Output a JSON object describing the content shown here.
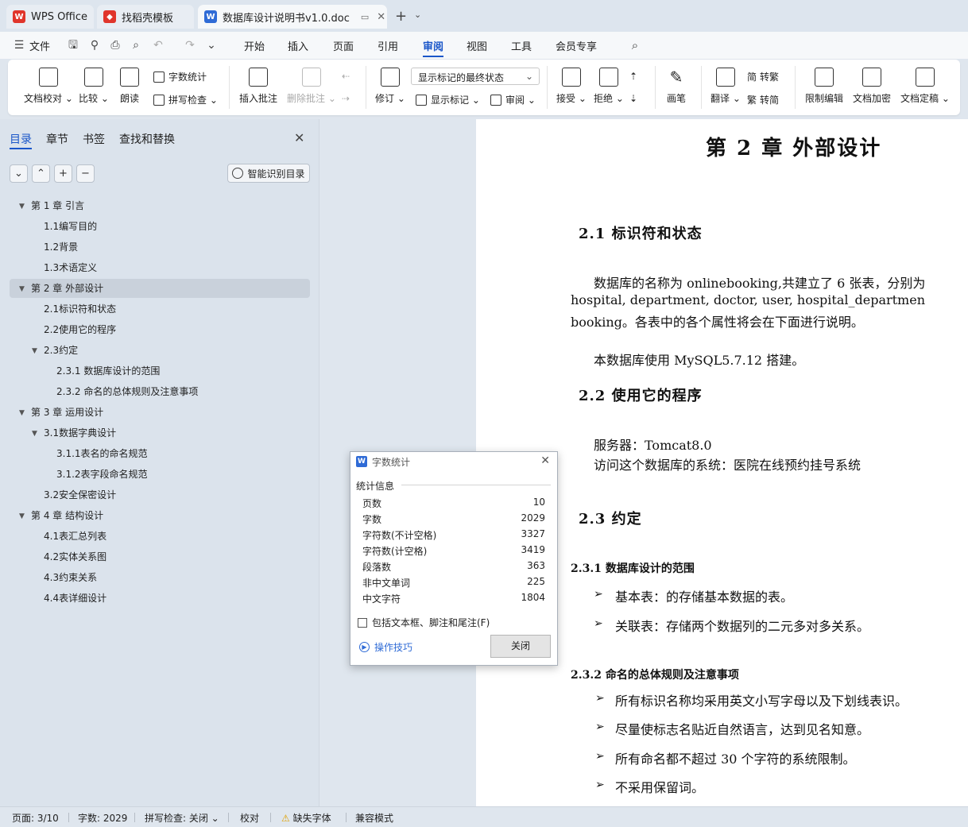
{
  "tabs": [
    {
      "label": "WPS Office",
      "icon": "wps-logo-icon",
      "color": "#e0352b"
    },
    {
      "label": "找稻壳模板",
      "icon": "docer-icon",
      "color": "#e0352b"
    },
    {
      "label": "数据库设计说明书v1.0.doc",
      "icon": "word-doc-icon",
      "color": "#2f6bd6"
    }
  ],
  "menu": {
    "file": "文件",
    "items": [
      "开始",
      "插入",
      "页面",
      "引用",
      "审阅",
      "视图",
      "工具",
      "会员专享"
    ],
    "active": "审阅",
    "accent": "#1a56c9"
  },
  "ribbon": {
    "doc_proofread": "文档校对",
    "compare": "比较",
    "read_aloud": "朗读",
    "word_count": "字数统计",
    "spell_check": "拼写检查",
    "insert_comment": "插入批注",
    "delete_comment": "删除批注",
    "revise": "修订",
    "markup_state": "显示标记的最终状态",
    "show_markup": "显示标记",
    "review": "审阅",
    "accept": "接受",
    "reject": "拒绝",
    "pen": "画笔",
    "translate": "翻译",
    "to_traditional": "转繁",
    "to_simplified": "转简",
    "restrict_edit": "限制编辑",
    "doc_encrypt": "文档加密",
    "doc_finalize": "文档定稿"
  },
  "nav": {
    "tabs": [
      "目录",
      "章节",
      "书签",
      "查找和替换"
    ],
    "smart_toc": "智能识别目录",
    "toc": [
      {
        "label": "第 1 章 引言",
        "level": 1,
        "expanded": true
      },
      {
        "label": "1.1编写目的",
        "level": 2
      },
      {
        "label": "1.2背景",
        "level": 2
      },
      {
        "label": "1.3术语定义",
        "level": 2
      },
      {
        "label": "第 2 章 外部设计",
        "level": 1,
        "expanded": true,
        "selected": true
      },
      {
        "label": "2.1标识符和状态",
        "level": 2
      },
      {
        "label": "2.2使用它的程序",
        "level": 2
      },
      {
        "label": "2.3约定",
        "level": 2,
        "expanded": true
      },
      {
        "label": "2.3.1 数据库设计的范围",
        "level": 3
      },
      {
        "label": "2.3.2 命名的总体规则及注意事项",
        "level": 3
      },
      {
        "label": "第 3 章 运用设计",
        "level": 1,
        "expanded": true
      },
      {
        "label": "3.1数据字典设计",
        "level": 2,
        "expanded": true
      },
      {
        "label": "3.1.1表名的命名规范",
        "level": 3
      },
      {
        "label": "3.1.2表字段命名规范",
        "level": 3
      },
      {
        "label": "3.2安全保密设计",
        "level": 2
      },
      {
        "label": "第 4 章 结构设计",
        "level": 1,
        "expanded": true
      },
      {
        "label": "4.1表汇总列表",
        "level": 2
      },
      {
        "label": "4.2实体关系图",
        "level": 2
      },
      {
        "label": "4.3约束关系",
        "level": 2
      },
      {
        "label": "4.4表详细设计",
        "level": 2
      }
    ]
  },
  "doc": {
    "chapter_title": "第 2 章  外部设计",
    "h_2_1": "2.1  标识符和状态",
    "p1_l1": "数据库的名称为 onlinebooking,共建立了 6 张表，分别为",
    "p1_l2": "hospital, department, doctor, user, hospital_departmen",
    "p1_l3": "booking。各表中的各个属性将会在下面进行说明。",
    "p2": "本数据库使用 MySQL5.7.12 搭建。",
    "h_2_2": "2.2  使用它的程序",
    "server": "服务器：Tomcat8.0",
    "system": "访问这个数据库的系统：医院在线预约挂号系统",
    "h_2_3": "2.3  约定",
    "h_2_3_1": "2.3.1 数据库设计的范围",
    "b1": "基本表：的存储基本数据的表。",
    "b2": "关联表：存储两个数据列的二元多对多关系。",
    "h_2_3_2": "2.3.2 命名的总体规则及注意事项",
    "b3": "所有标识名称均采用英文小写字母以及下划线表识。",
    "b4": "尽量使标志名贴近自然语言，达到见名知意。",
    "b5": "所有命名都不超过 30 个字符的系统限制。",
    "b6": "不采用保留词。"
  },
  "dialog": {
    "title": "字数统计",
    "section": "统计信息",
    "rows": [
      {
        "label": "页数",
        "value": "10"
      },
      {
        "label": "字数",
        "value": "2029"
      },
      {
        "label": "字符数(不计空格)",
        "value": "3327"
      },
      {
        "label": "字符数(计空格)",
        "value": "3419"
      },
      {
        "label": "段落数",
        "value": "363"
      },
      {
        "label": "非中文单词",
        "value": "225"
      },
      {
        "label": "中文字符",
        "value": "1804"
      }
    ],
    "include_label": "包括文本框、脚注和尾注(F)",
    "tips": "操作技巧",
    "close": "关闭"
  },
  "status": {
    "page": "页面: 3/10",
    "words": "字数: 2029",
    "spell": "拼写检查: 关闭",
    "proof": "校对",
    "missing_font": "缺失字体",
    "compat": "兼容模式"
  }
}
